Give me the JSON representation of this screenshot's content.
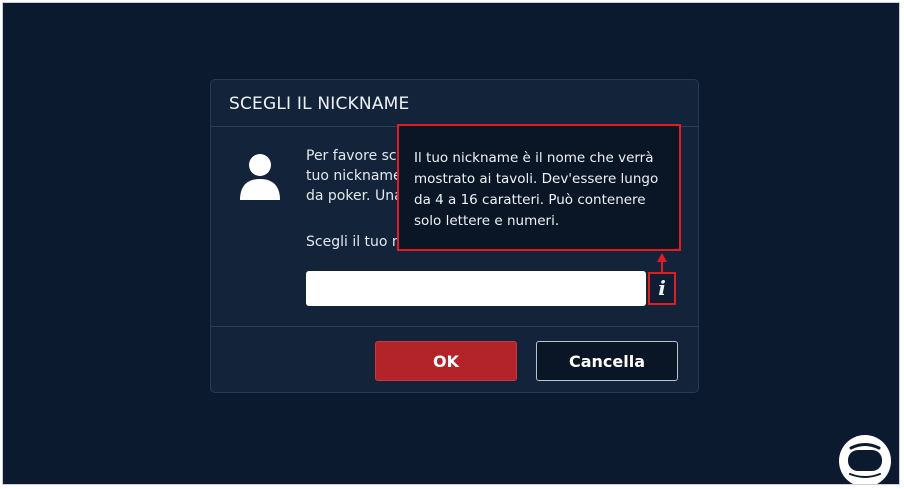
{
  "dialog": {
    "title": "SCEGLI IL NICKNAME",
    "message_lines": [
      "Per favore sce",
      "tuo nickname",
      "da poker. Una"
    ],
    "prompt": "Scegli il tuo n",
    "nickname_input": {
      "value": "",
      "placeholder": ""
    },
    "ok_label": "OK",
    "cancel_label": "Cancella"
  },
  "tooltip": {
    "lines": [
      "Il tuo nickname è il nome che verrà",
      "mostrato ai tavoli. Dev'essere lungo",
      "da 4 a 16 caratteri. Può contenere",
      "solo lettere e numeri."
    ]
  },
  "info_button": {
    "label": "i",
    "icon": "info-icon"
  },
  "colors": {
    "background": "#0b1a2e",
    "dialog": "#13243a",
    "ok_button": "#b3232a",
    "highlight": "#e21c22"
  }
}
